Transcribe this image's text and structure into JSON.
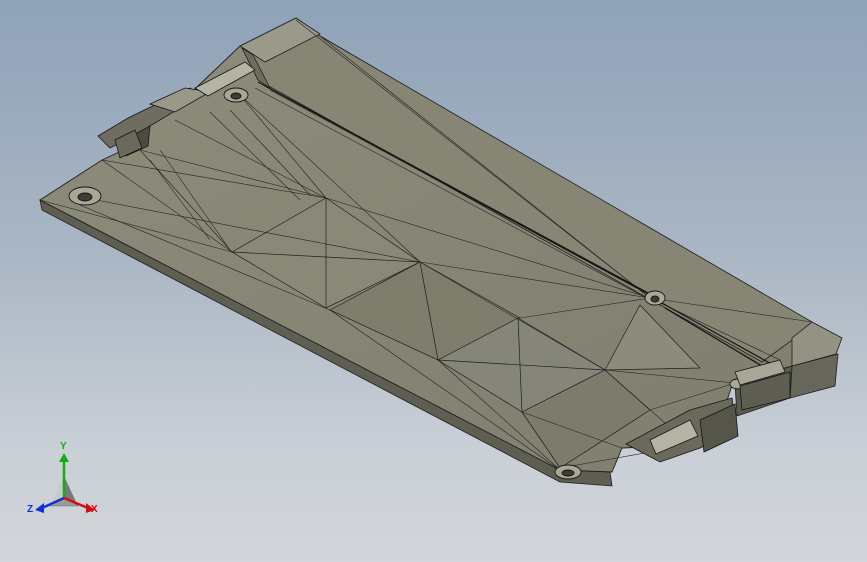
{
  "viewport": {
    "background_top": "#8fa2b8",
    "background_bottom": "#d3d6da",
    "model_color": "#8a8a7a",
    "edge_color": "#1e1e1e"
  },
  "triad": {
    "x_label": "X",
    "y_label": "Y",
    "z_label": "Z",
    "x_color": "#d01010",
    "y_color": "#10b010",
    "z_color": "#1030d0"
  }
}
